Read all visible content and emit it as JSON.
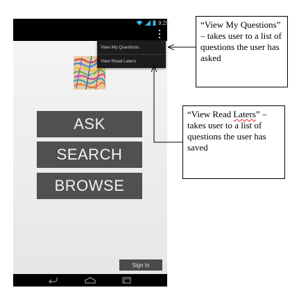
{
  "status_bar": {
    "time": "9:25"
  },
  "menu": {
    "items": [
      {
        "label": "View My Questions"
      },
      {
        "label": "View Read Laters"
      }
    ]
  },
  "main": {
    "ask_label": "ASK",
    "search_label": "SEARCH",
    "browse_label": "BROWSE",
    "signin_label": "Sign In"
  },
  "callouts": {
    "questions": "“View My Questions” – takes user to a list of questions the user has asked",
    "readlaters_prefix": "“View Read ",
    "readlaters_word": "Laters",
    "readlaters_suffix": "” – takes user to a list of questions the user has saved"
  },
  "colors": {
    "button_bg": "#505050",
    "frame": "#000000",
    "menu_bg": "#1c1c1c"
  }
}
